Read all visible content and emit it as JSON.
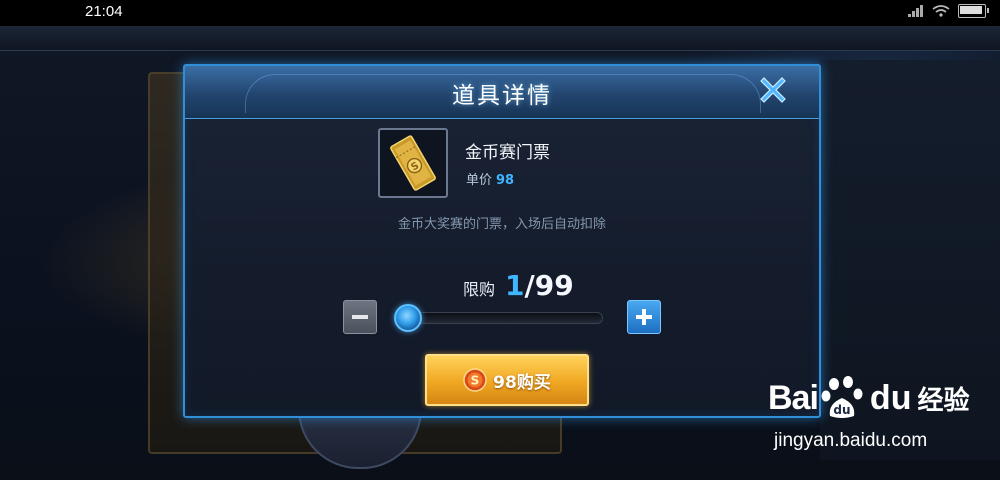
{
  "status_bar": {
    "time": "21:04"
  },
  "dialog": {
    "title": "道具详情",
    "item": {
      "name": "金币赛门票",
      "price_label": "单价",
      "price_value": "98",
      "description": "金币大奖赛的门票，入场后自动扣除"
    },
    "quantity": {
      "label": "限购",
      "current": "1",
      "separator": "/",
      "max": "99",
      "slider_fraction": 0.0
    },
    "buy_button_label": "98购买"
  },
  "watermark": {
    "brand_left": "Bai",
    "brand_right": "du",
    "product": "经验",
    "url": "jingyan.baidu.com"
  },
  "colors": {
    "accent_blue": "#3fb6ff",
    "dialog_border": "#2f8fd9",
    "buy_button": "#f0a722"
  },
  "icons": [
    "close-icon",
    "ticket-icon",
    "coin-icon",
    "minus-icon",
    "plus-icon",
    "baidu-paw-icon"
  ]
}
